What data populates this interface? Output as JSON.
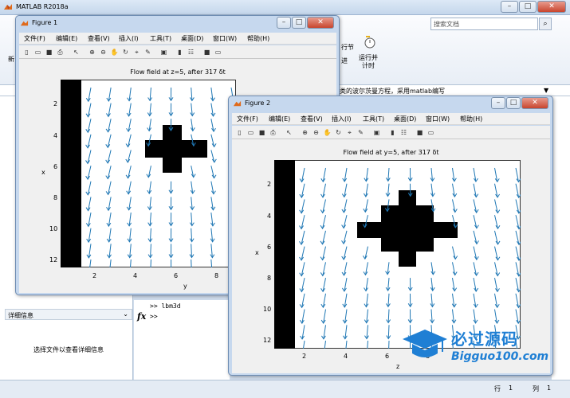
{
  "app": {
    "title": "MATLAB R2018a"
  },
  "search": {
    "placeholder": "搜索文档"
  },
  "ribbon": {
    "item1": "行节",
    "item2": "进",
    "item3": "运行并\n计时",
    "item4": "新"
  },
  "address": {
    "text": "类的波尔茨曼方程，采用matlab编写"
  },
  "details": {
    "header": "详细信息",
    "text": "选择文件以查看详细信息"
  },
  "command": {
    "fx": "fx",
    "line1": ">> lbm3d",
    "line2": ">>"
  },
  "status": {
    "row_label": "行",
    "row_value": "1",
    "col_label": "列",
    "col_value": "1"
  },
  "fig1": {
    "title": "Figure 1",
    "menu": [
      "文件(F)",
      "编辑(E)",
      "查看(V)",
      "插入(I)",
      "工具(T)",
      "桌面(D)",
      "窗口(W)",
      "帮助(H)"
    ],
    "plot_title": "Flow field at z=5, after 317",
    "plot_title_symbol": "δt",
    "xlabel": "y",
    "ylabel": "x",
    "xticks": [
      "2",
      "4",
      "6",
      "8"
    ],
    "yticks": [
      "2",
      "4",
      "6",
      "8",
      "10",
      "12"
    ]
  },
  "fig2": {
    "title": "Figure 2",
    "menu": [
      "文件(F)",
      "编辑(E)",
      "查看(V)",
      "插入(I)",
      "工具(T)",
      "桌面(D)",
      "窗口(W)",
      "帮助(H)"
    ],
    "plot_title": "Flow field at y=5, after 317",
    "plot_title_symbol": "δt",
    "xlabel": "z",
    "ylabel": "x",
    "xticks": [
      "2",
      "4",
      "6",
      "8"
    ],
    "yticks": [
      "2",
      "4",
      "6",
      "8",
      "10",
      "12"
    ]
  },
  "watermark": {
    "line1": "必过源码",
    "line2": "Bigguo100.com"
  },
  "colors": {
    "arrow": "#1f77b4",
    "obstacle": "#000000",
    "titlebar": "#c6d8ee",
    "accent": "#1f7fd4"
  }
}
